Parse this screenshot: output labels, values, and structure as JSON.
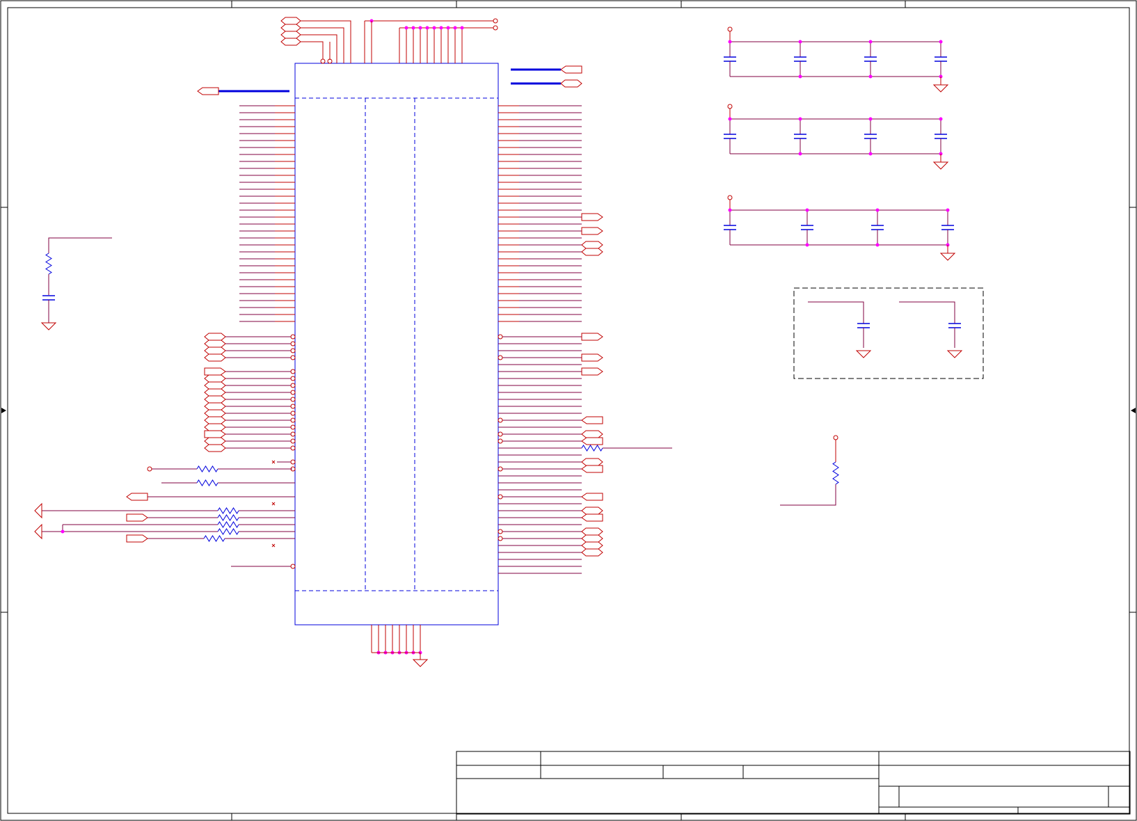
{
  "colors": {
    "wire": "#c00000",
    "net": "#800040",
    "part_body": "#0000dd",
    "junction": "#ff00ff",
    "frame": "#000000",
    "background": "#ffffff"
  },
  "icons": {
    "ground": "ground-symbol-icon",
    "power_pin": "power-pin-icon",
    "port": "port-flag-icon",
    "capacitor": "capacitor-icon",
    "resistor": "resistor-icon",
    "no_connect": "no-connect-icon"
  },
  "title_block": {
    "title": "",
    "size": "",
    "document_number": "",
    "revision": "",
    "date": "",
    "sheet": ""
  }
}
